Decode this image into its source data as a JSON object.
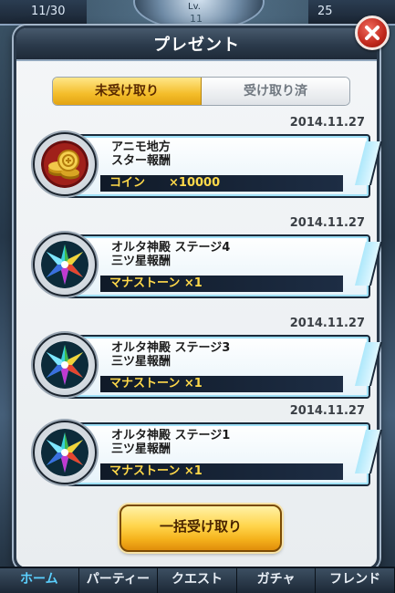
{
  "background": {
    "top_left_text": "11/30",
    "top_right_text": "25",
    "emblem_label": "Lv.",
    "emblem_value": "11"
  },
  "dialog": {
    "title": "プレゼント",
    "close_icon": "close-x-icon",
    "tabs": [
      {
        "label": "未受け取り",
        "active": true
      },
      {
        "label": "受け取り済",
        "active": false
      }
    ],
    "items": [
      {
        "date": "2014.11.27",
        "title": "アニモ地方\nスター報酬",
        "reward": "コイン　　×10000",
        "icon": "gold-coins-icon"
      },
      {
        "date": "2014.11.27",
        "title": "オルタ神殿 ステージ4\n三ツ星報酬",
        "reward": "マナストーン ×1",
        "icon": "mana-stone-star-icon"
      },
      {
        "date": "2014.11.27",
        "title": "オルタ神殿 ステージ3\n三ツ星報酬",
        "reward": "マナストーン ×1",
        "icon": "mana-stone-star-icon"
      },
      {
        "date": "2014.11.27",
        "title": "オルタ神殿 ステージ1\n三ツ星報酬",
        "reward": "マナストーン ×1",
        "icon": "mana-stone-star-icon"
      }
    ],
    "claim_all_label": "一括受け取り"
  },
  "nav": {
    "items": [
      {
        "label": "ホーム",
        "active": true
      },
      {
        "label": "パーティー",
        "active": false
      },
      {
        "label": "クエスト",
        "active": false
      },
      {
        "label": "ガチャ",
        "active": false
      },
      {
        "label": "フレンド",
        "active": false
      }
    ]
  },
  "colors": {
    "tab_active": "#f4bd2a",
    "reward_text": "#ffd94a",
    "close_button": "#c0281c",
    "nav_active": "#5bd0ff"
  }
}
